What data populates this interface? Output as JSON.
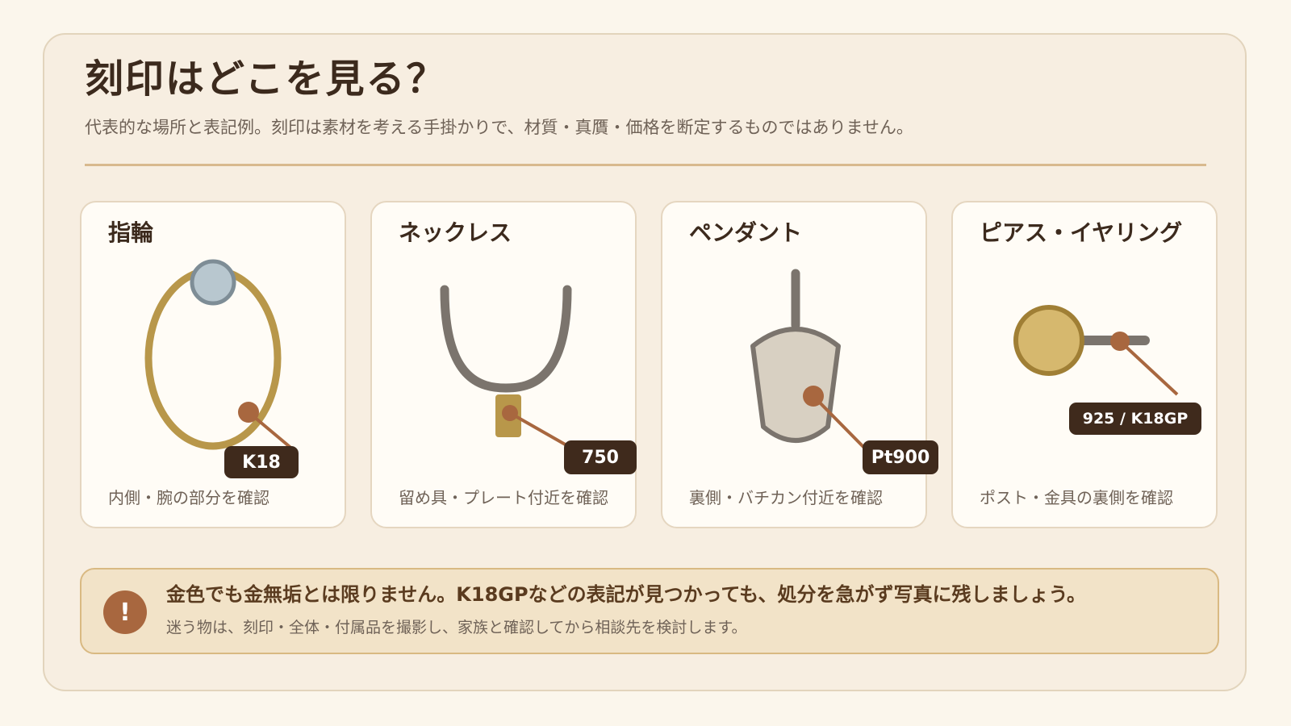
{
  "header": {
    "title": "刻印はどこを見る？",
    "subtitle": "代表的な場所と表記例。刻印は素材を考える手掛かりで、材質・真贋・価格を断定するものではありません。"
  },
  "cards": [
    {
      "title": "指輪",
      "icon": "ring-icon",
      "mark": "K18",
      "caption": "内側・腕の部分を確認"
    },
    {
      "title": "ネックレス",
      "icon": "necklace-icon",
      "mark": "750",
      "caption": "留め具・プレート付近を確認"
    },
    {
      "title": "ペンダント",
      "icon": "pendant-icon",
      "mark": "Pt900",
      "caption": "裏側・バチカン付近を確認"
    },
    {
      "title": "ピアス・イヤリング",
      "icon": "earring-icon",
      "mark": "925 / K18GP",
      "caption": "ポスト・金具の裏側を確認"
    }
  ],
  "notice": {
    "icon": "exclamation-icon",
    "icon_glyph": "!",
    "main": "金色でも金無垢とは限りません。K18GPなどの表記が見つかっても、処分を急がず写真に残しましょう。",
    "sub": "迷う物は、刻印・全体・付属品を撮影し、家族と確認してから相談先を検討します。"
  },
  "colors": {
    "background": "#fbf6ec",
    "panel": "#f7eee1",
    "accent_rule": "#d8b98e",
    "gold": "#b8974a",
    "metal_gray": "#7b746d",
    "marker": "#a8673f",
    "badge": "#3f2a1c",
    "notice_bg": "#f2e3c8"
  }
}
